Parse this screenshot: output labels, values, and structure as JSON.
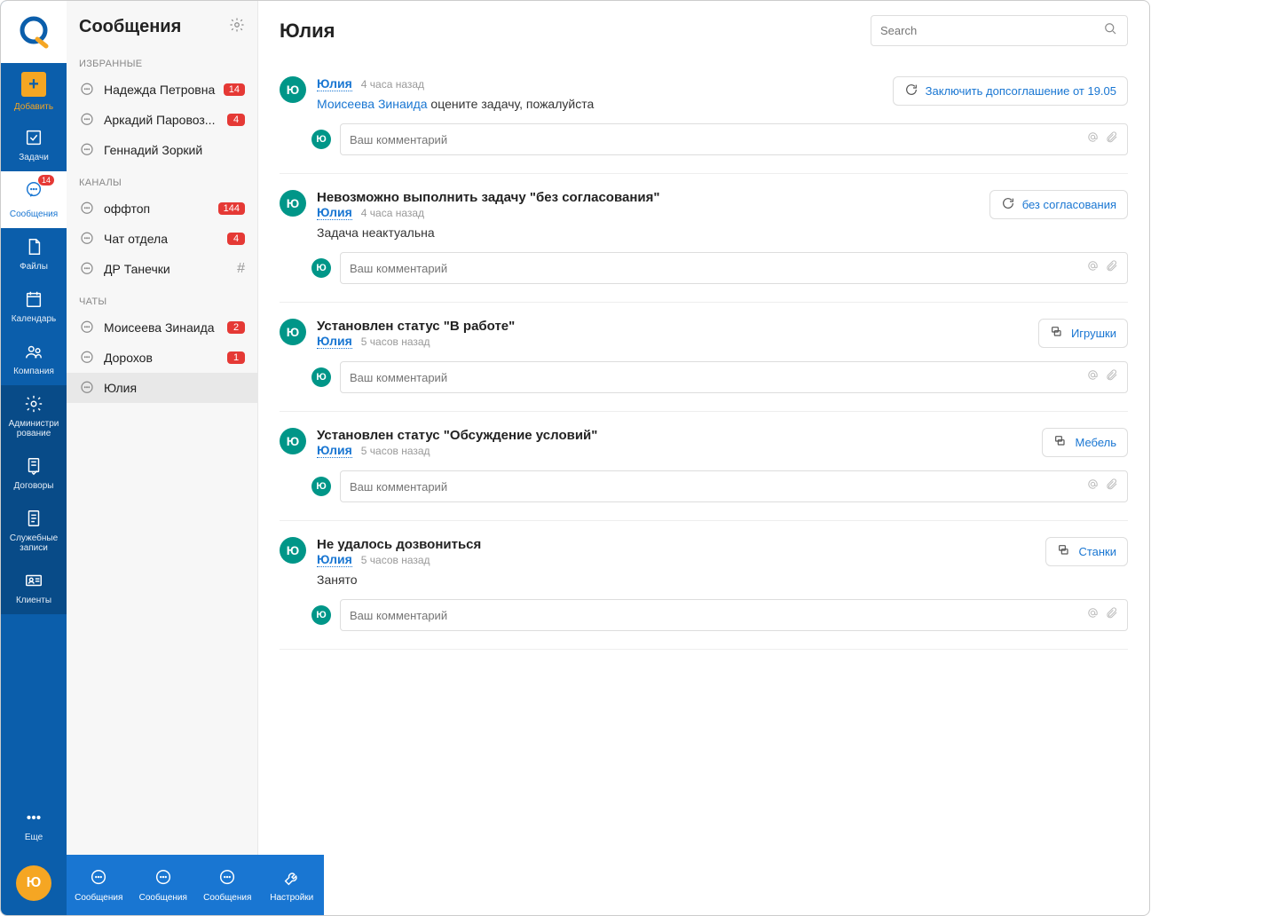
{
  "rail": {
    "add": "Добавить",
    "tasks": "Задачи",
    "messages": "Сообщения",
    "messages_badge": "14",
    "files": "Файлы",
    "calendar": "Календарь",
    "company": "Компания",
    "admin": "Администри рование",
    "contracts": "Договоры",
    "memos": "Служебные записи",
    "clients": "Клиенты",
    "more": "Еще",
    "user_initial": "Ю"
  },
  "sidebar": {
    "title": "Сообщения",
    "sections": {
      "favorites": "ИЗБРАННЫЕ",
      "channels": "КАНАЛЫ",
      "chats": "ЧАТЫ"
    },
    "favorites": [
      {
        "name": "Надежда Петровна",
        "badge": "14"
      },
      {
        "name": "Аркадий Паровоз...",
        "badge": "4"
      },
      {
        "name": "Геннадий Зоркий",
        "badge": null
      }
    ],
    "channels": [
      {
        "name": "оффтоп",
        "badge": "144"
      },
      {
        "name": "Чат отдела",
        "badge": "4"
      },
      {
        "name": "ДР Танечки",
        "badge": null,
        "hash": true
      }
    ],
    "chats": [
      {
        "name": "Моисеева Зинаида",
        "badge": "2"
      },
      {
        "name": "Дорохов",
        "badge": "1"
      },
      {
        "name": "Юлия",
        "badge": null,
        "selected": true
      }
    ]
  },
  "tabs": {
    "t1": "Сообщения",
    "t2": "Сообщения",
    "t3": "Сообщения",
    "t4": "Настройки"
  },
  "header": {
    "title": "Юлия",
    "search_placeholder": "Search"
  },
  "comment_placeholder": "Ваш комментарий",
  "posts": [
    {
      "avatar": "Ю",
      "author": "Юлия",
      "time": "4 часа назад",
      "action": "Заключить допсоглашение от 19.05",
      "action_icon": "refresh",
      "title": null,
      "body_mention": "Моисеева Зинаида",
      "body_text": " оцените задачу, пожалуйста"
    },
    {
      "avatar": "Ю",
      "author": "Юлия",
      "time": "4 часа назад",
      "action": "без согласования",
      "action_icon": "refresh",
      "title": "Невозможно выполнить задачу \"без согласования\"",
      "body_text": "Задача неактуальна"
    },
    {
      "avatar": "Ю",
      "author": "Юлия",
      "time": "5 часов назад",
      "action": "Игрушки",
      "action_icon": "stack",
      "title": "Установлен статус \"В работе\"",
      "body_text": null
    },
    {
      "avatar": "Ю",
      "author": "Юлия",
      "time": "5 часов назад",
      "action": "Мебель",
      "action_icon": "stack",
      "title": "Установлен статус \"Обсуждение условий\"",
      "body_text": null
    },
    {
      "avatar": "Ю",
      "author": "Юлия",
      "time": "5 часов назад",
      "action": "Станки",
      "action_icon": "stack",
      "title": "Не удалось дозвониться",
      "body_text": "Занято"
    }
  ]
}
